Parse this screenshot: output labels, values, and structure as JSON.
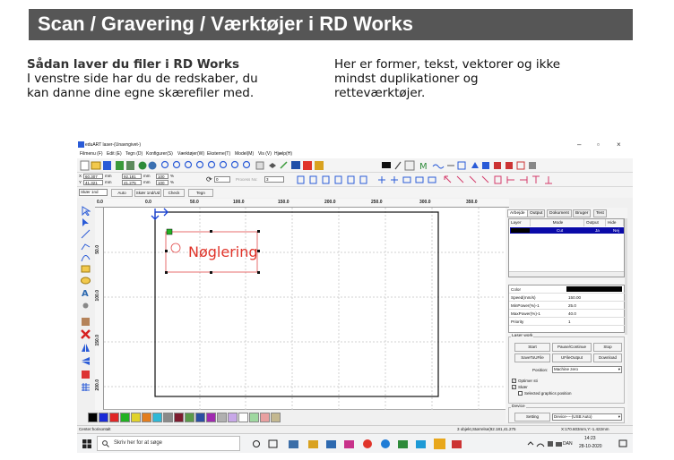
{
  "header": {
    "title": "Scan / Gravering / Værktøjer i RD Works"
  },
  "text": {
    "left_heading": "Sådan laver du filer i RD Works",
    "left_line1": "I venstre side har du de redskaber, du",
    "left_line2": "kan danne dine egne skærefiler med.",
    "right_line1": "Her er former, tekst, vektorer og ikke",
    "right_line2": "mindst duplikationer og",
    "right_line3": "retteværktøjer."
  },
  "app": {
    "title": "eduART laser-(Unavngivet-)",
    "menu": [
      "Filmenu (F)",
      "Edit (E)",
      "Tegn (D)",
      "Konfigurer(S)",
      "Værktøjer(W)",
      "Eksterne(T)",
      "Model(M)",
      "Vis (V)",
      "Hjælp(H)"
    ],
    "coords": {
      "x_label": "X",
      "y_label": "Y",
      "x_val": "60.307",
      "y_val": "41.321",
      "unit": "mm",
      "w_val": "92.181",
      "h_val": "41.275",
      "pct1": "100",
      "pct2": "100",
      "pct_unit": "%",
      "rot": "0",
      "process_no_label": "Process No:",
      "process_no": "3"
    },
    "tb3": {
      "skaer": "Skær 1nd",
      "auto": "Auto",
      "skaer2": "Skær 1nd/Ud",
      "check": "Check",
      "tegn": "Tegn"
    },
    "ruler_h": [
      "0.0",
      "0.0",
      "50.0",
      "100.0",
      "150.0",
      "200.0",
      "250.0",
      "300.0",
      "350.0"
    ],
    "ruler_v": [
      "50.0",
      "100.0",
      "150.0",
      "200.0"
    ],
    "canvas_text": "Nøglering",
    "status_left": "Center:horisontalt",
    "status_mid": "3 objekt,Størrelse(92.181,41.275",
    "status_right": "X:170.603mm,Y:-1.422mm"
  },
  "panel": {
    "tabs": [
      "Arbejde",
      "Output",
      "Dokument",
      "Bruger",
      "Test"
    ],
    "layer_headers": [
      "Layer",
      "Mode",
      "Output",
      "Hide"
    ],
    "layer_row": {
      "mode": "Cut",
      "output": "Ja",
      "hide": "Nej"
    },
    "props": [
      {
        "k": "Color",
        "v": ""
      },
      {
        "k": "Speed(mm/s)",
        "v": "150.00"
      },
      {
        "k": "MinPower(%)-1",
        "v": "25.0"
      },
      {
        "k": "MaxPower(%)-1",
        "v": "40.0"
      },
      {
        "k": "Priority",
        "v": "1"
      }
    ],
    "laser_work": "Laser work",
    "buttons": [
      "Start",
      "Pause/Continue",
      "Stop",
      "SaveToUFile",
      "UFileOutput",
      "Download"
    ],
    "position_label": "Position:",
    "position_value": "Machine zero",
    "checks": [
      "Optimer sti",
      "Skær",
      "Selected graphics position"
    ],
    "device_label": "Device",
    "setting": "Setting",
    "device_value": "Device----(USB:Auto)"
  },
  "taskbar": {
    "search_placeholder": "Skriv her for at søge",
    "lang": "DAN",
    "time": "14:23",
    "date": "28-10-2020"
  },
  "colors": {
    "banner": "#565656",
    "selection": "#0a0aa8",
    "canvas_text": "#e0342a",
    "palette": [
      "#000000",
      "#1a2bd6",
      "#e02626",
      "#23b123",
      "#e0d22b",
      "#e37e1f",
      "#2fb8d6",
      "#8a8a8a",
      "#7d1c2f",
      "#5a9a4a",
      "#2b4ea3",
      "#a02ab0",
      "#b0b0b0",
      "#c8a8e8",
      "#ffffff",
      "#9fd8a0",
      "#e8a0a0",
      "#c4b890"
    ]
  }
}
